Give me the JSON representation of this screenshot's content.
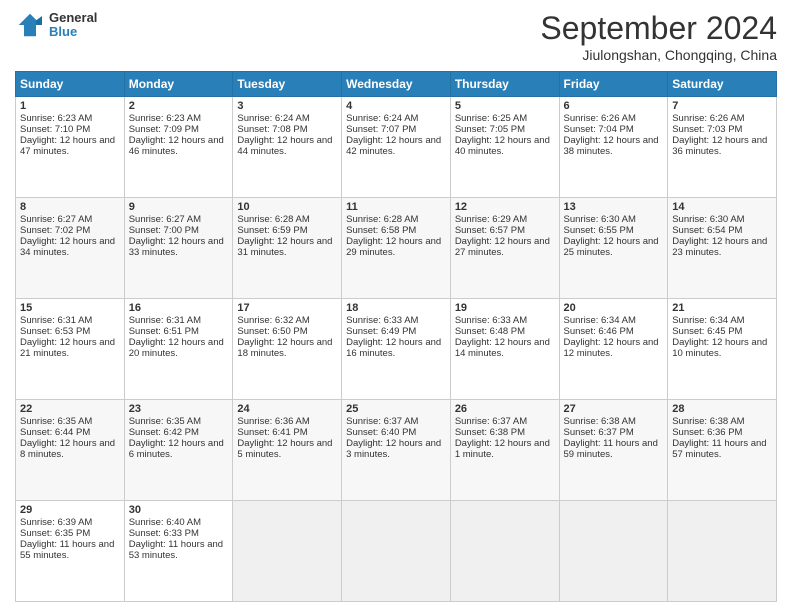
{
  "logo": {
    "general": "General",
    "blue": "Blue"
  },
  "header": {
    "month": "September 2024",
    "location": "Jiulongshan, Chongqing, China"
  },
  "days": [
    "Sunday",
    "Monday",
    "Tuesday",
    "Wednesday",
    "Thursday",
    "Friday",
    "Saturday"
  ],
  "weeks": [
    [
      {
        "day": "1",
        "sunrise": "6:23 AM",
        "sunset": "7:10 PM",
        "daylight": "12 hours and 47 minutes."
      },
      {
        "day": "2",
        "sunrise": "6:23 AM",
        "sunset": "7:09 PM",
        "daylight": "12 hours and 46 minutes."
      },
      {
        "day": "3",
        "sunrise": "6:24 AM",
        "sunset": "7:08 PM",
        "daylight": "12 hours and 44 minutes."
      },
      {
        "day": "4",
        "sunrise": "6:24 AM",
        "sunset": "7:07 PM",
        "daylight": "12 hours and 42 minutes."
      },
      {
        "day": "5",
        "sunrise": "6:25 AM",
        "sunset": "7:05 PM",
        "daylight": "12 hours and 40 minutes."
      },
      {
        "day": "6",
        "sunrise": "6:26 AM",
        "sunset": "7:04 PM",
        "daylight": "12 hours and 38 minutes."
      },
      {
        "day": "7",
        "sunrise": "6:26 AM",
        "sunset": "7:03 PM",
        "daylight": "12 hours and 36 minutes."
      }
    ],
    [
      {
        "day": "8",
        "sunrise": "6:27 AM",
        "sunset": "7:02 PM",
        "daylight": "12 hours and 34 minutes."
      },
      {
        "day": "9",
        "sunrise": "6:27 AM",
        "sunset": "7:00 PM",
        "daylight": "12 hours and 33 minutes."
      },
      {
        "day": "10",
        "sunrise": "6:28 AM",
        "sunset": "6:59 PM",
        "daylight": "12 hours and 31 minutes."
      },
      {
        "day": "11",
        "sunrise": "6:28 AM",
        "sunset": "6:58 PM",
        "daylight": "12 hours and 29 minutes."
      },
      {
        "day": "12",
        "sunrise": "6:29 AM",
        "sunset": "6:57 PM",
        "daylight": "12 hours and 27 minutes."
      },
      {
        "day": "13",
        "sunrise": "6:30 AM",
        "sunset": "6:55 PM",
        "daylight": "12 hours and 25 minutes."
      },
      {
        "day": "14",
        "sunrise": "6:30 AM",
        "sunset": "6:54 PM",
        "daylight": "12 hours and 23 minutes."
      }
    ],
    [
      {
        "day": "15",
        "sunrise": "6:31 AM",
        "sunset": "6:53 PM",
        "daylight": "12 hours and 21 minutes."
      },
      {
        "day": "16",
        "sunrise": "6:31 AM",
        "sunset": "6:51 PM",
        "daylight": "12 hours and 20 minutes."
      },
      {
        "day": "17",
        "sunrise": "6:32 AM",
        "sunset": "6:50 PM",
        "daylight": "12 hours and 18 minutes."
      },
      {
        "day": "18",
        "sunrise": "6:33 AM",
        "sunset": "6:49 PM",
        "daylight": "12 hours and 16 minutes."
      },
      {
        "day": "19",
        "sunrise": "6:33 AM",
        "sunset": "6:48 PM",
        "daylight": "12 hours and 14 minutes."
      },
      {
        "day": "20",
        "sunrise": "6:34 AM",
        "sunset": "6:46 PM",
        "daylight": "12 hours and 12 minutes."
      },
      {
        "day": "21",
        "sunrise": "6:34 AM",
        "sunset": "6:45 PM",
        "daylight": "12 hours and 10 minutes."
      }
    ],
    [
      {
        "day": "22",
        "sunrise": "6:35 AM",
        "sunset": "6:44 PM",
        "daylight": "12 hours and 8 minutes."
      },
      {
        "day": "23",
        "sunrise": "6:35 AM",
        "sunset": "6:42 PM",
        "daylight": "12 hours and 6 minutes."
      },
      {
        "day": "24",
        "sunrise": "6:36 AM",
        "sunset": "6:41 PM",
        "daylight": "12 hours and 5 minutes."
      },
      {
        "day": "25",
        "sunrise": "6:37 AM",
        "sunset": "6:40 PM",
        "daylight": "12 hours and 3 minutes."
      },
      {
        "day": "26",
        "sunrise": "6:37 AM",
        "sunset": "6:38 PM",
        "daylight": "12 hours and 1 minute."
      },
      {
        "day": "27",
        "sunrise": "6:38 AM",
        "sunset": "6:37 PM",
        "daylight": "11 hours and 59 minutes."
      },
      {
        "day": "28",
        "sunrise": "6:38 AM",
        "sunset": "6:36 PM",
        "daylight": "11 hours and 57 minutes."
      }
    ],
    [
      {
        "day": "29",
        "sunrise": "6:39 AM",
        "sunset": "6:35 PM",
        "daylight": "11 hours and 55 minutes."
      },
      {
        "day": "30",
        "sunrise": "6:40 AM",
        "sunset": "6:33 PM",
        "daylight": "11 hours and 53 minutes."
      },
      null,
      null,
      null,
      null,
      null
    ]
  ]
}
